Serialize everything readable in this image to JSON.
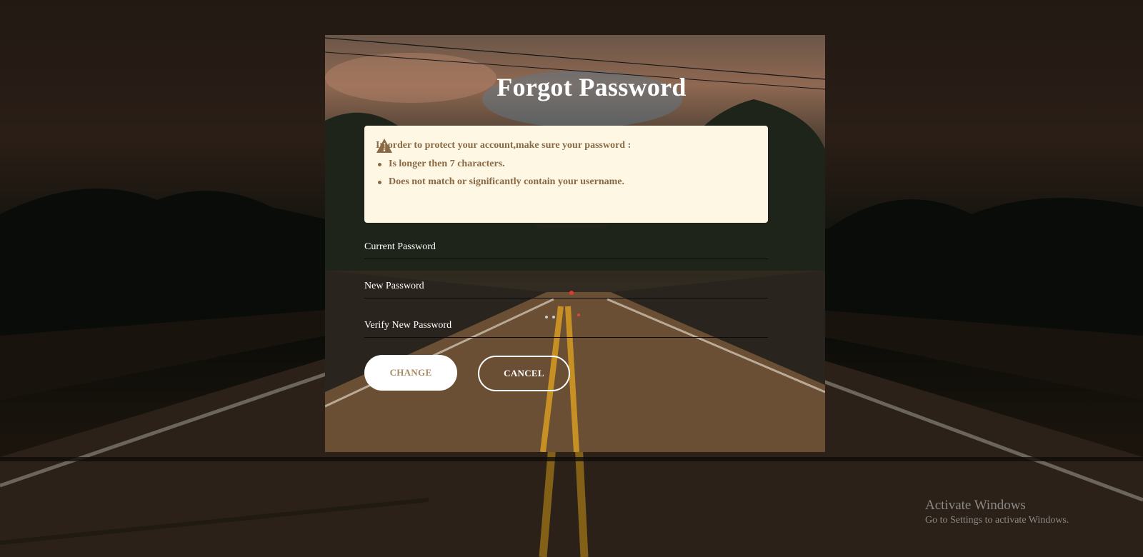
{
  "title": "Forgot Password",
  "notice": {
    "icon": "warning-triangle-icon",
    "heading": "In order to protect your account,make sure your password :",
    "rules": [
      "Is longer then 7 characters.",
      "Does not match or significantly contain your username."
    ]
  },
  "fields": {
    "current": {
      "label": "Current Password",
      "value": ""
    },
    "new": {
      "label": "New Password",
      "value": ""
    },
    "verify": {
      "label": "Verify New Password",
      "value": ""
    }
  },
  "buttons": {
    "change": "CHANGE",
    "cancel": "CANCEL"
  },
  "watermark": {
    "line1": "Activate Windows",
    "line2": "Go to Settings to activate Windows."
  },
  "colors": {
    "notice_bg": "#fef7e3",
    "notice_text": "#8a6a45",
    "change_text": "#a68a63"
  }
}
